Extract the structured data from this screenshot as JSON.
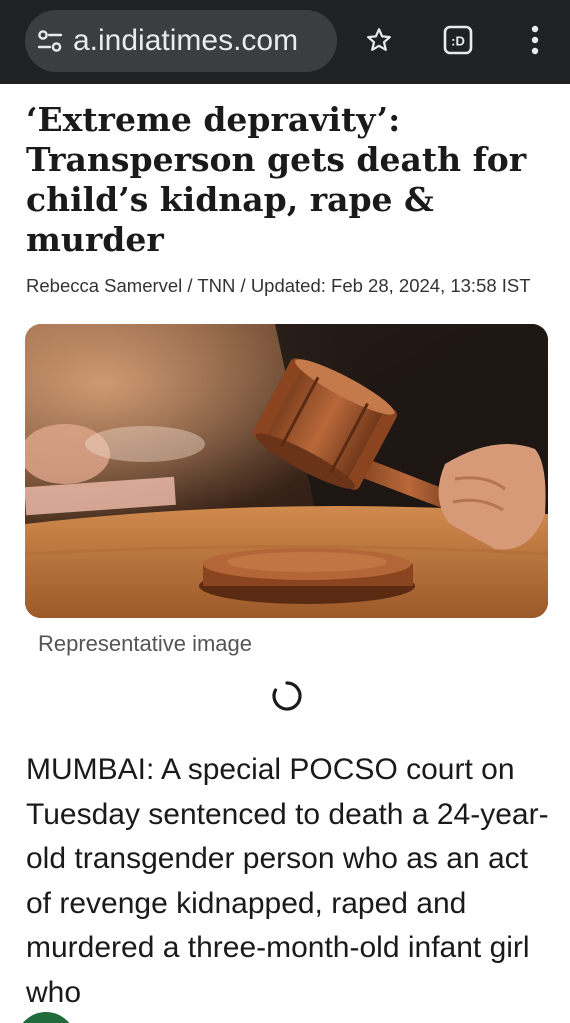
{
  "browser": {
    "url": "a.indiatimes.com",
    "icons": {
      "site_info": "site-info-icon",
      "bookmark": "star-icon",
      "tabs": "tab-switcher-icon",
      "menu": "more-vert-icon"
    },
    "tab_label": ":D",
    "colors": {
      "toolbar_bg": "#202124",
      "urlbar_bg": "#3c3d40",
      "text": "#e8eaed"
    }
  },
  "article": {
    "headline": "‘Extreme depravity’: Transperson gets death for child’s kidnap, rape & murder",
    "byline": "Rebecca Samervel / TNN / Updated: Feb 28, 2024, 13:58 IST",
    "image_caption": "Representative image",
    "body": "MUMBAI: A special POCSO court on Tuesday sentenced to death a 24-year-old transgender person who as an act of revenge kidnapped, raped and murdered a three-month-old infant girl who"
  },
  "icons": {
    "loading": "loading-spinner-icon",
    "hero": "gavel-image"
  }
}
